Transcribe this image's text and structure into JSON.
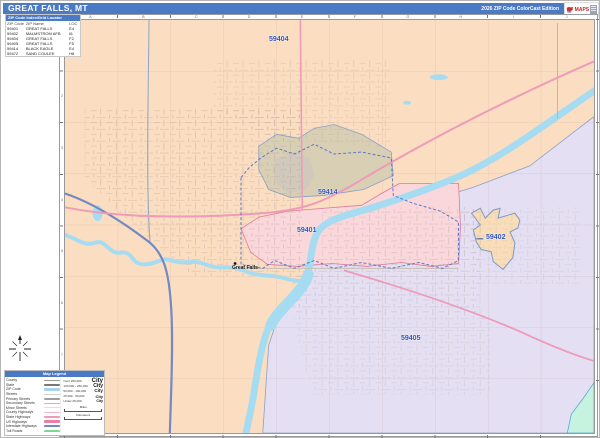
{
  "header": {
    "title": "GREAT FALLS, MT",
    "edition": "2026 ZIP Code ColorCast Edition",
    "logo_brand": "MAPS"
  },
  "zip_table": {
    "title": "ZIP Code Index/Grid Locator",
    "columns": {
      "zip": "ZIP Code",
      "name": "ZIP Name",
      "loc": "LOC"
    },
    "rows": [
      {
        "zip": "59401",
        "name": "GREAT FALLS",
        "loc": "E4"
      },
      {
        "zip": "59402",
        "name": "MALMSTROM AFB",
        "loc": "I6"
      },
      {
        "zip": "59404",
        "name": "GREAT FALLS",
        "loc": "F2"
      },
      {
        "zip": "59405",
        "name": "GREAT FALLS",
        "loc": "F5"
      },
      {
        "zip": "59414",
        "name": "BLACK EAGLE",
        "loc": "E4"
      },
      {
        "zip": "59472",
        "name": "SAND COULEE",
        "loc": "H8"
      }
    ]
  },
  "map": {
    "zip_labels": [
      {
        "text": "59404"
      },
      {
        "text": "59414"
      },
      {
        "text": "59401"
      },
      {
        "text": "59402"
      },
      {
        "text": "59405"
      }
    ],
    "city_label": "Great Falls",
    "grid_letters": [
      "A",
      "B",
      "C",
      "D",
      "E",
      "F",
      "G",
      "H",
      "I",
      "J"
    ],
    "grid_numbers": [
      "1",
      "2",
      "3",
      "4",
      "5",
      "6",
      "7",
      "8"
    ]
  },
  "legend": {
    "title": "Map Legend",
    "road_items": [
      {
        "label": "County"
      },
      {
        "label": "State"
      },
      {
        "label": "ZIP Code"
      },
      {
        "label": "Streets"
      },
      {
        "label": "Primary Streets"
      },
      {
        "label": "Secondary Streets"
      },
      {
        "label": "Minor Streets"
      },
      {
        "label": "County Highways"
      },
      {
        "label": "State Highways"
      },
      {
        "label": "US Highways"
      },
      {
        "label": "Interstate Highways"
      },
      {
        "label": "Toll Roads"
      }
    ],
    "city_classes": [
      {
        "range": "Over 250,000",
        "sample": "City"
      },
      {
        "range": "100,000 - 250,000",
        "sample": "City"
      },
      {
        "range": "50,000 - 100,000",
        "sample": "City"
      },
      {
        "range": "25,000 - 50,000",
        "sample": "City"
      },
      {
        "range": "Under 25,000",
        "sample": "City"
      }
    ],
    "scales": {
      "miles": "Miles",
      "kilometers": "Kilometers"
    }
  },
  "colors": {
    "title_bar": "#4b7ac5",
    "zip_59404_fill": "#fbddc1",
    "zip_59405_fill": "#e4dff2",
    "zip_59401_fill": "#f9d7da",
    "zip_59414_fill": "#d9cfb4",
    "zip_59402_fill": "#f8ddb8",
    "river": "#a6dcf2",
    "zip_label_text": "#2f52bd",
    "us_highway": "#ef9ab8",
    "interstate": "#7289c2",
    "city_boundary": "#4f6cc8"
  }
}
